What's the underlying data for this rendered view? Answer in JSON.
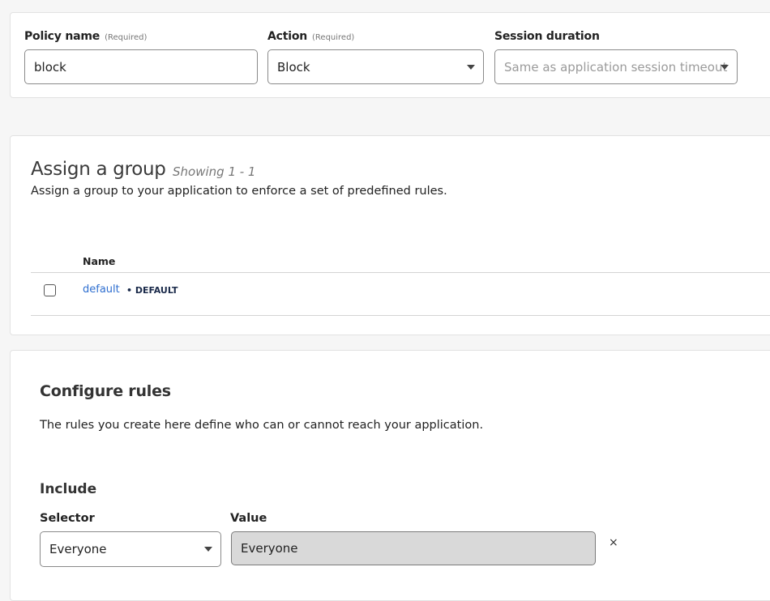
{
  "policy": {
    "name_label": "Policy name",
    "name_required": "(Required)",
    "name_value": "block",
    "action_label": "Action",
    "action_required": "(Required)",
    "action_value": "Block",
    "session_label": "Session duration",
    "session_value": "Same as application session timeout"
  },
  "assign_group": {
    "title": "Assign a group",
    "showing": "Showing 1 - 1",
    "description": "Assign a group to your application to enforce a set of predefined rules.",
    "columns": [
      "Name"
    ],
    "rows": [
      {
        "name": "default",
        "tag": "• DEFAULT",
        "checked": false
      }
    ]
  },
  "configure_rules": {
    "title": "Configure rules",
    "description": "The rules you create here define who can or cannot reach your application.",
    "include_title": "Include",
    "selector_label": "Selector",
    "value_label": "Value",
    "selector_value": "Everyone",
    "value_value": "Everyone",
    "remove_glyph": "×"
  },
  "icons": {
    "dropdown": "caret-down-icon",
    "remove": "close-icon",
    "checkbox": "checkbox-unchecked"
  },
  "colors": {
    "link": "#2f6fd0",
    "readonly_field_bg": "#d9d9d9",
    "card_border": "#e2e2e2"
  }
}
